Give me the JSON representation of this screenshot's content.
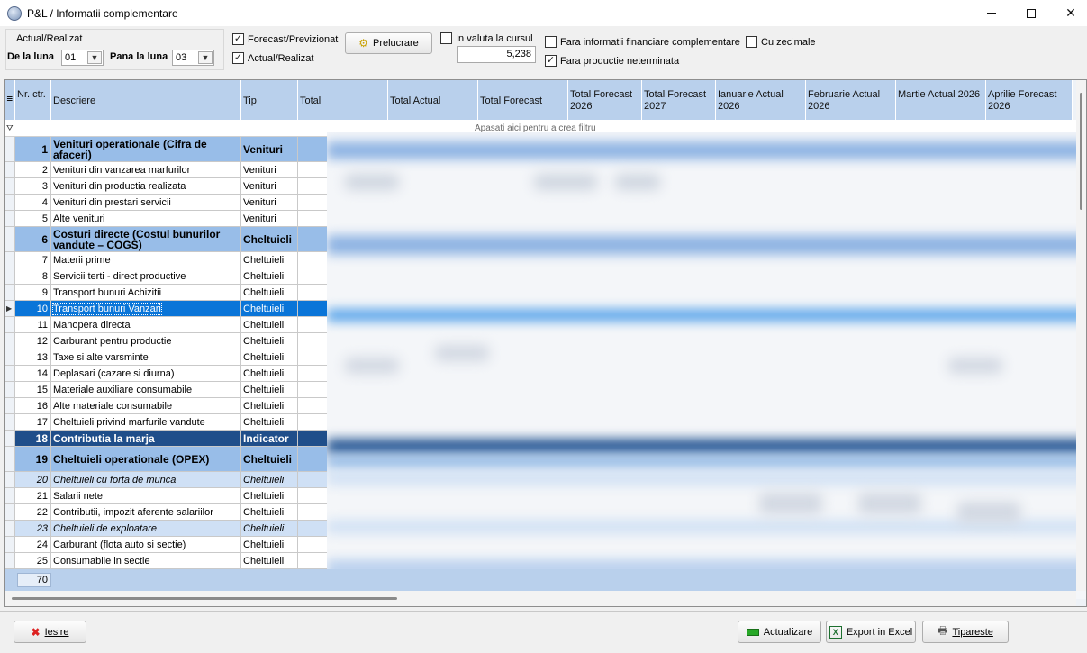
{
  "window": {
    "title": "P&L / Informatii complementare"
  },
  "filters": {
    "group_title": "Actual/Realizat",
    "from_label": "De la luna",
    "from_value": "01",
    "to_label": "Pana la luna",
    "to_value": "03",
    "forecast_label": "Forecast/Previzionat",
    "forecast_checked": "✓",
    "actual_label": "Actual/Realizat",
    "actual_checked": "✓",
    "process_button": "Prelucrare",
    "currency_label": "In valuta la cursul",
    "currency_rate": "5,238",
    "no_fin_info_label": "Fara informatii financiare complementare",
    "wip_label": "Fara productie neterminata",
    "wip_checked": "✓",
    "decimals_label": "Cu zecimale"
  },
  "grid": {
    "columns": [
      {
        "key": "nr",
        "label": "Nr. ctr."
      },
      {
        "key": "desc",
        "label": "Descriere"
      },
      {
        "key": "tip",
        "label": "Tip"
      },
      {
        "key": "total",
        "label": "Total"
      },
      {
        "key": "total_actual",
        "label": "Total Actual"
      },
      {
        "key": "total_forecast",
        "label": "Total Forecast"
      },
      {
        "key": "tf2026",
        "label": "Total Forecast 2026"
      },
      {
        "key": "tf2027",
        "label": "Total Forecast 2027"
      },
      {
        "key": "ian",
        "label": "Ianuarie Actual 2026"
      },
      {
        "key": "feb",
        "label": "Februarie Actual 2026"
      },
      {
        "key": "mar",
        "label": "Martie Actual 2026"
      },
      {
        "key": "apr",
        "label": "Aprilie Forecast 2026"
      }
    ],
    "filter_hint": "Apasati aici pentru a  crea filtru",
    "rows": [
      {
        "nr": "1",
        "desc": "Venituri operationale (Cifra de afaceri)",
        "tip": "Venituri",
        "style": "grp"
      },
      {
        "nr": "2",
        "desc": "Venituri din vanzarea marfurilor",
        "tip": "Venituri",
        "style": ""
      },
      {
        "nr": "3",
        "desc": "Venituri din productia realizata",
        "tip": "Venituri",
        "style": ""
      },
      {
        "nr": "4",
        "desc": "Venituri din prestari servicii",
        "tip": "Venituri",
        "style": ""
      },
      {
        "nr": "5",
        "desc": "Alte venituri",
        "tip": "Venituri",
        "style": ""
      },
      {
        "nr": "6",
        "desc": "Costuri directe (Costul bunurilor vandute – COGS)",
        "tip": "Cheltuieli",
        "style": "grp"
      },
      {
        "nr": "7",
        "desc": "Materii prime",
        "tip": "Cheltuieli",
        "style": ""
      },
      {
        "nr": "8",
        "desc": "Servicii terti  - direct productive",
        "tip": "Cheltuieli",
        "style": ""
      },
      {
        "nr": "9",
        "desc": "Transport bunuri Achizitii",
        "tip": "Cheltuieli",
        "style": ""
      },
      {
        "nr": "10",
        "desc": "Transport bunuri Vanzari",
        "tip": "Cheltuieli",
        "style": "active"
      },
      {
        "nr": "11",
        "desc": "Manopera directa",
        "tip": "Cheltuieli",
        "style": ""
      },
      {
        "nr": "12",
        "desc": "Carburant pentru productie",
        "tip": "Cheltuieli",
        "style": ""
      },
      {
        "nr": "13",
        "desc": "Taxe si alte varsminte",
        "tip": "Cheltuieli",
        "style": ""
      },
      {
        "nr": "14",
        "desc": "Deplasari (cazare si diurna)",
        "tip": "Cheltuieli",
        "style": ""
      },
      {
        "nr": "15",
        "desc": "Materiale auxiliare consumabile",
        "tip": "Cheltuieli",
        "style": ""
      },
      {
        "nr": "16",
        "desc": "Alte materiale consumabile",
        "tip": "Cheltuieli",
        "style": ""
      },
      {
        "nr": "17",
        "desc": "Cheltuieli privind marfurile vandute",
        "tip": "Cheltuieli",
        "style": ""
      },
      {
        "nr": "18",
        "desc": "Contributia la marja",
        "tip": "Indicator",
        "style": "ind"
      },
      {
        "nr": "19",
        "desc": "Cheltuieli operationale (OPEX)",
        "tip": "Cheltuieli",
        "style": "grp"
      },
      {
        "nr": "20",
        "desc": "Cheltuieli cu forta de munca",
        "tip": "Cheltuieli",
        "style": "sub"
      },
      {
        "nr": "21",
        "desc": "Salarii nete",
        "tip": "Cheltuieli",
        "style": ""
      },
      {
        "nr": "22",
        "desc": "Contributii, impozit aferente salariilor",
        "tip": "Cheltuieli",
        "style": ""
      },
      {
        "nr": "23",
        "desc": "Cheltuieli de exploatare",
        "tip": "Cheltuieli",
        "style": "sub"
      },
      {
        "nr": "24",
        "desc": "Carburant (flota auto si sectie)",
        "tip": "Cheltuieli",
        "style": ""
      },
      {
        "nr": "25",
        "desc": "Consumabile in sectie",
        "tip": "Cheltuieli",
        "style": ""
      }
    ],
    "row_count": "70"
  },
  "buttons": {
    "exit": "Iesire",
    "refresh": "Actualizare",
    "export_excel": "Export in Excel",
    "print": "Tipareste"
  }
}
